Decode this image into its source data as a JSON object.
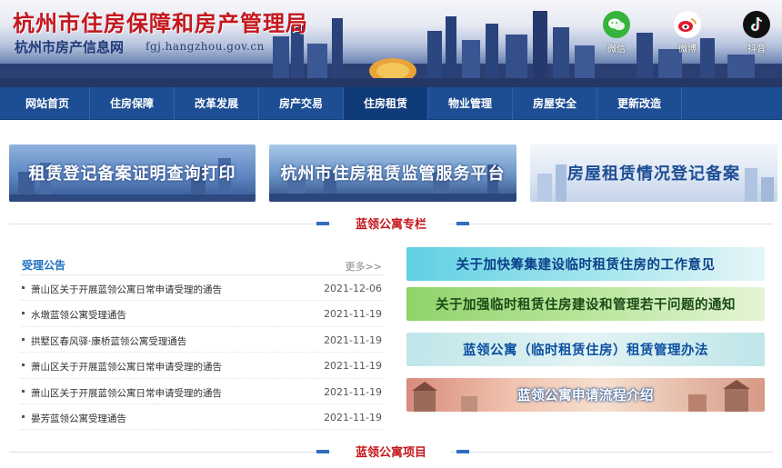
{
  "header": {
    "title": "杭州市住房保障和房产管理局",
    "subtitle": "杭州市房产信息网",
    "url": "fgj.hangzhou.gov.cn",
    "social": [
      {
        "label": "微信",
        "icon": "wechat-icon",
        "color": "#36b33c"
      },
      {
        "label": "微博",
        "icon": "weibo-icon",
        "color": "#e6162d"
      },
      {
        "label": "抖音",
        "icon": "douyin-icon",
        "color": "#111111"
      }
    ]
  },
  "nav": {
    "items": [
      {
        "label": "网站首页"
      },
      {
        "label": "住房保障"
      },
      {
        "label": "改革发展"
      },
      {
        "label": "房产交易"
      },
      {
        "label": "住房租赁"
      },
      {
        "label": "物业管理"
      },
      {
        "label": "房屋安全"
      },
      {
        "label": "更新改造"
      }
    ],
    "active_label": "住房租赁"
  },
  "banners": [
    {
      "label": "租赁登记备案证明查询打印"
    },
    {
      "label": "杭州市住房租赁监管服务平台"
    },
    {
      "label": "房屋租赁情况登记备案"
    }
  ],
  "section1": {
    "title": "蓝领公寓专栏"
  },
  "notices": {
    "title": "受理公告",
    "more": "更多>>",
    "items": [
      {
        "title": "萧山区关于开展蓝领公寓日常申请受理的通告",
        "date": "2021-12-06"
      },
      {
        "title": "水墩蓝领公寓受理通告",
        "date": "2021-11-19"
      },
      {
        "title": "拱墅区春风驿·康桥蓝领公寓受理通告",
        "date": "2021-11-19"
      },
      {
        "title": "萧山区关于开展蓝领公寓日常申请受理的通告",
        "date": "2021-11-19"
      },
      {
        "title": "萧山区关于开展蓝领公寓日常申请受理的通告",
        "date": "2021-11-19"
      },
      {
        "title": "晏芳蓝领公寓受理通告",
        "date": "2021-11-19"
      }
    ]
  },
  "policies": [
    {
      "label": "关于加快筹集建设临时租赁住房的工作意见"
    },
    {
      "label": "关于加强临时租赁住房建设和管理若干问题的通知"
    },
    {
      "label": "蓝领公寓（临时租赁住房）租赁管理办法"
    },
    {
      "label": "蓝领公寓申请流程介绍"
    }
  ],
  "section2": {
    "title": "蓝领公寓项目"
  }
}
